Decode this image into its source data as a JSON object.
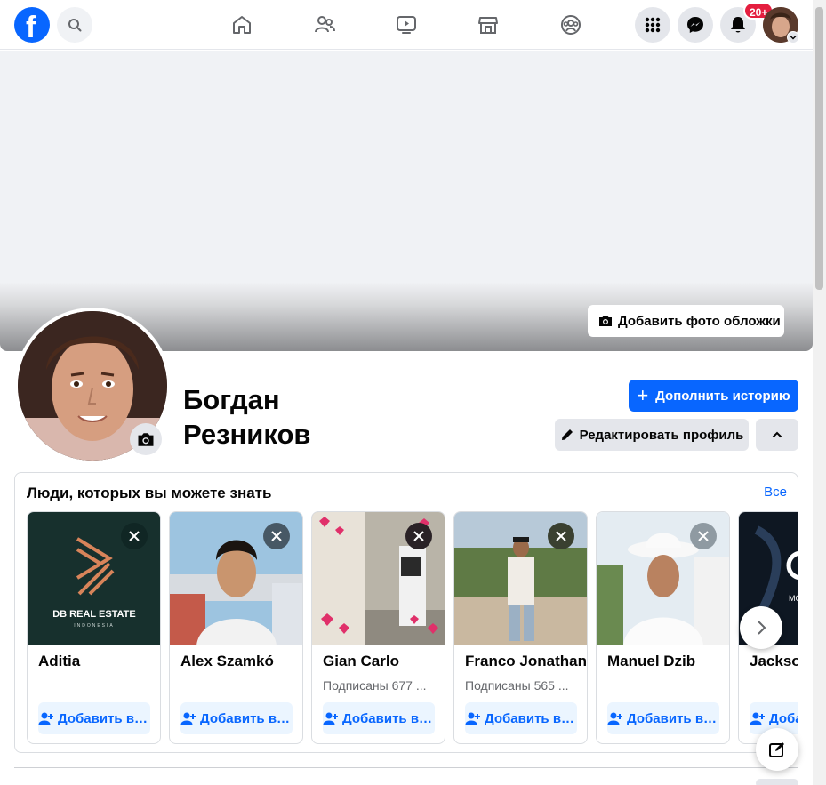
{
  "topbar": {
    "logo_letter": "f",
    "notifications_badge": "20+",
    "icons": [
      "facebook-logo",
      "search-icon",
      "home-icon",
      "friends-icon",
      "video-icon",
      "marketplace-icon",
      "groups-icon",
      "menu-grid-icon",
      "messenger-icon",
      "bell-icon"
    ]
  },
  "cover": {
    "add_cover_label": "Добавить фото обложки"
  },
  "profile": {
    "name_line1": "Богдан",
    "name_line2": "Резников",
    "add_story_label": "Дополнить историю",
    "edit_profile_label": "Редактировать профиль"
  },
  "pymk": {
    "title": "Люди, которых вы можете знать",
    "see_all": "Все",
    "cards": [
      {
        "name": "Aditia",
        "mutual": "",
        "add_label": "Добавить в друзья",
        "image_text": "DB REAL ESTATE",
        "image_subtext": "INDONESIA"
      },
      {
        "name": "Alex Szamkó",
        "mutual": "",
        "add_label": "Добавить в друзья"
      },
      {
        "name": "Gian Carlo",
        "mutual": "Подписаны 677 ...",
        "add_label": "Добавить в друзья"
      },
      {
        "name": "Franco Jonathan",
        "mutual": "Подписаны 565 ...",
        "add_label": "Добавить в друзья"
      },
      {
        "name": "Manuel Dzib",
        "mutual": "",
        "add_label": "Добавить в друзья"
      },
      {
        "name": "Jackson",
        "mutual": "",
        "add_label": "Добав",
        "image_text": "MODE"
      }
    ]
  },
  "colors": {
    "brand": "#0866ff",
    "badge": "#e41e3f",
    "secondary_btn": "#e4e6eb"
  }
}
